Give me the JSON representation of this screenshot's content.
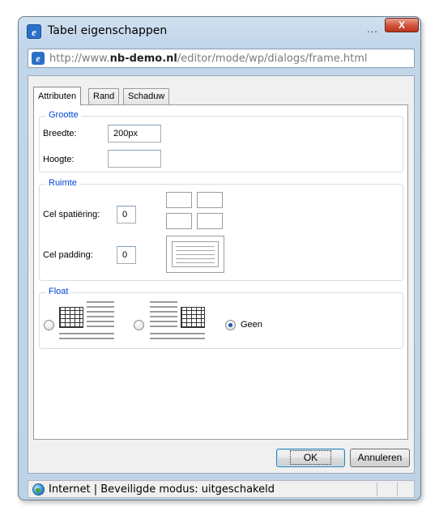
{
  "window": {
    "title": "Tabel eigenschappen",
    "title_dots": "...",
    "close_glyph": "X"
  },
  "address": {
    "prefix": "http://www.",
    "domain": "nb-demo.nl",
    "path": "/editor/mode/wp/dialogs/frame.html"
  },
  "tabs": [
    {
      "label": "Attributen",
      "active": true
    },
    {
      "label": "Rand",
      "active": false
    },
    {
      "label": "Schaduw",
      "active": false
    }
  ],
  "grootte": {
    "legend": "Grootte",
    "breedte_label": "Breedte:",
    "breedte_value": "200px",
    "hoogte_label": "Hoogte:",
    "hoogte_value": ""
  },
  "ruimte": {
    "legend": "Ruimte",
    "spatiering_label": "Cel spatiëring:",
    "spatiering_value": "0",
    "padding_label": "Cel padding:",
    "padding_value": "0"
  },
  "float": {
    "legend": "Float",
    "options": [
      {
        "name": "left",
        "selected": false
      },
      {
        "name": "right",
        "selected": false
      },
      {
        "name": "none",
        "label": "Geen",
        "selected": true
      }
    ]
  },
  "buttons": {
    "ok": "OK",
    "cancel": "Annuleren"
  },
  "status": {
    "text": "Internet | Beveiligde modus: uitgeschakeld"
  },
  "colors": {
    "legend": "#0046d5",
    "close_button": "#d3573f",
    "frame": "#c2d6ea"
  },
  "icons": {
    "title": "ie-icon",
    "address": "ie-icon",
    "status": "globe-icon"
  }
}
